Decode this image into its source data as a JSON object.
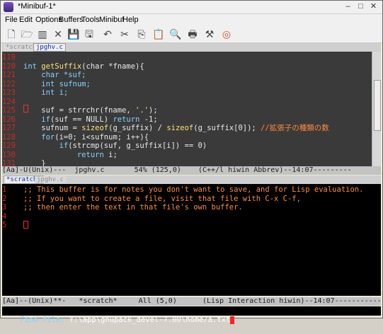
{
  "window": {
    "title": "*Minibuf-1*",
    "min_label": "–",
    "max_label": "□",
    "close_label": "✕"
  },
  "menu": [
    "File",
    "Edit",
    "Options",
    "Buffers",
    "Tools",
    "Minibuf",
    "Help"
  ],
  "toolbar_icons": [
    {
      "name": "new-file-icon",
      "glyph": "🗋"
    },
    {
      "name": "open-folder-icon",
      "glyph": "🗁"
    },
    {
      "name": "save-icon",
      "glyph": "▥"
    },
    {
      "name": "close-icon",
      "glyph": "✕"
    },
    {
      "name": "save-disk-icon",
      "glyph": "💾"
    },
    {
      "name": "save-as-icon",
      "glyph": "🖫"
    },
    {
      "name": "undo-icon",
      "glyph": "↶"
    },
    {
      "name": "cut-icon",
      "glyph": "✂"
    },
    {
      "name": "copy-icon",
      "glyph": "⎘"
    },
    {
      "name": "paste-icon",
      "glyph": "📋"
    },
    {
      "name": "search-icon",
      "glyph": "🔍"
    },
    {
      "name": "print-icon",
      "glyph": "🖶"
    },
    {
      "name": "preferences-icon",
      "glyph": "⚒"
    },
    {
      "name": "help-icon",
      "glyph": "◎"
    }
  ],
  "top_tabs": [
    {
      "label": "*scratch*",
      "active": false
    },
    {
      "label": "jpghv.c",
      "active": true
    }
  ],
  "code_pane": {
    "lines": [
      {
        "no": "119",
        "text": ""
      },
      {
        "no": "120",
        "segments": [
          {
            "t": "int ",
            "c": "kw"
          },
          {
            "t": "getSuffix",
            "c": "fn"
          },
          {
            "t": "(char *fname){",
            "c": ""
          }
        ]
      },
      {
        "no": "121",
        "segments": [
          {
            "t": "    char *suf;",
            "c": "kw"
          }
        ]
      },
      {
        "no": "122",
        "segments": [
          {
            "t": "    int sufnum;",
            "c": "kw"
          }
        ]
      },
      {
        "no": "123",
        "segments": [
          {
            "t": "    int i;",
            "c": "kw"
          }
        ]
      },
      {
        "no": "124",
        "text": ""
      },
      {
        "no": "125",
        "segments": [
          {
            "t": "    suf = strrchr(fname, ",
            "c": ""
          },
          {
            "t": "'.'",
            "c": "str"
          },
          {
            "t": ");",
            "c": ""
          }
        ]
      },
      {
        "no": "126",
        "segments": [
          {
            "t": "    if",
            "c": "kw"
          },
          {
            "t": "(suf == NULL) ",
            "c": ""
          },
          {
            "t": "return",
            "c": "kw"
          },
          {
            "t": " -1;",
            "c": ""
          }
        ]
      },
      {
        "no": "127",
        "segments": [
          {
            "t": "    sufnum = ",
            "c": ""
          },
          {
            "t": "sizeof",
            "c": "fn"
          },
          {
            "t": "(g_suffix) / ",
            "c": ""
          },
          {
            "t": "sizeof",
            "c": "fn"
          },
          {
            "t": "(g_suffix[0]); ",
            "c": ""
          },
          {
            "t": "//拡張子の種類の数",
            "c": "cm"
          }
        ]
      },
      {
        "no": "128",
        "segments": [
          {
            "t": "    for",
            "c": "kw"
          },
          {
            "t": "(i=0; i<sufnum; i++){",
            "c": ""
          }
        ]
      },
      {
        "no": "129",
        "segments": [
          {
            "t": "        if",
            "c": "kw"
          },
          {
            "t": "(strcmp(suf, g_suffix[i]) == 0)",
            "c": ""
          }
        ]
      },
      {
        "no": "130",
        "segments": [
          {
            "t": "            return",
            "c": "kw"
          },
          {
            "t": " i;",
            "c": ""
          }
        ]
      },
      {
        "no": "131",
        "segments": [
          {
            "t": "    }",
            "c": ""
          }
        ]
      }
    ],
    "modeline": "[Aa]-U(Unix)---  jpghv.c       54% (125,0)    (C++/l hiwin Abbrev)--14:07---------"
  },
  "lower_tabs": [
    {
      "label": "*scratch*",
      "active": true
    },
    {
      "label": "jpghv.c",
      "active": false
    }
  ],
  "scratch_pane": {
    "lines": [
      {
        "no": "1",
        "text": ";; This buffer is for notes you don't want to save, and for Lisp evaluation."
      },
      {
        "no": "2",
        "text": ";; If you want to create a file, visit that file with C-x C-f,"
      },
      {
        "no": "3",
        "text": ";; then enter the text in that file's own buffer."
      },
      {
        "no": "4",
        "text": ""
      },
      {
        "no": "5",
        "text": ""
      }
    ],
    "modeline": "[Aa]--(Unix)**-   *scratch*     All (5,0)      (Lisp Interaction hiwin)--14:07-----------"
  },
  "minibuffer": {
    "prompt": "Find file: ",
    "value": "Y:\\app\\gnupack_devel-7.00\\home/a.txt"
  }
}
